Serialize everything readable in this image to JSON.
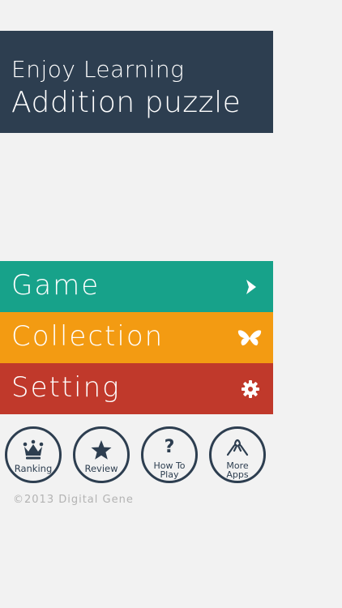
{
  "header": {
    "line1": "Enjoy Learning",
    "line2": "Addition puzzle"
  },
  "menu": {
    "items": [
      {
        "label": "Game",
        "icon": "chevron-right-icon",
        "color": "#17a28a"
      },
      {
        "label": "Collection",
        "icon": "butterfly-icon",
        "color": "#f39b12"
      },
      {
        "label": "Setting",
        "icon": "gear-icon",
        "color": "#c0392b"
      }
    ]
  },
  "circle_buttons": [
    {
      "label": "Ranking",
      "icon": "crown-icon"
    },
    {
      "label": "Review",
      "icon": "star-icon"
    },
    {
      "label_line1": "How To",
      "label_line2": "Play",
      "icon": "question-mark-icon",
      "glyph": "?"
    },
    {
      "label_line1": "More",
      "label_line2": "Apps",
      "icon": "hands-icon"
    }
  ],
  "footer": {
    "copyright": "©2013 Digital Gene"
  },
  "colors": {
    "navy": "#2d3e50",
    "background": "#f2f2f2",
    "copyright_text": "#b3b3b3"
  }
}
